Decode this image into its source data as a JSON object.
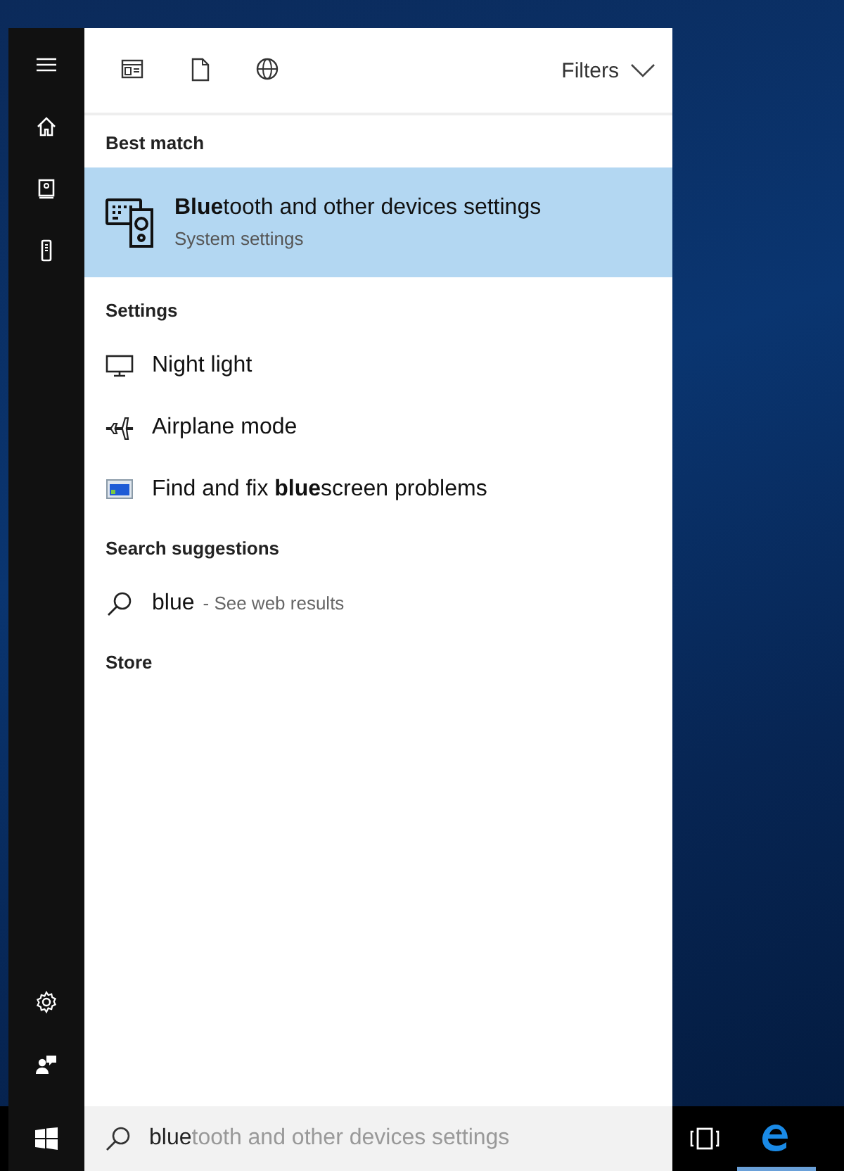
{
  "sidebar": {
    "top": [
      {
        "kind": "menu"
      },
      {
        "kind": "home"
      },
      {
        "kind": "notebook"
      },
      {
        "kind": "devices"
      }
    ],
    "bottom": [
      {
        "kind": "settings"
      },
      {
        "kind": "feedback"
      }
    ]
  },
  "filter_bar": {
    "tabs": [
      {
        "kind": "apps",
        "selected": false
      },
      {
        "kind": "documents",
        "selected": false
      },
      {
        "kind": "web",
        "selected": false
      }
    ],
    "filters_label": "Filters"
  },
  "sections": [
    {
      "heading": "Best match",
      "items": [
        {
          "kind": "bluetooth",
          "title": "**Blue**tooth and other devices settings",
          "subtitle": "System settings",
          "selected": true
        }
      ]
    },
    {
      "heading": "Settings",
      "items": [
        {
          "kind": "display",
          "title": "Night light",
          "selected": false
        },
        {
          "kind": "airplane",
          "title": "Airplane mode",
          "selected": false
        },
        {
          "kind": "troubleshoot",
          "title": "Find and fix **blue**screen problems",
          "selected": false
        }
      ]
    },
    {
      "heading": "Search suggestions",
      "items": [
        {
          "kind": "web",
          "title": "blue",
          "hint": "- See web results",
          "selected": false
        }
      ]
    },
    {
      "heading": "Store"
    }
  ],
  "taskbar": {
    "search": {
      "value": "blue",
      "suggestion": "tooth and other devices settings"
    },
    "apps": [
      {
        "kind": "task-view"
      },
      {
        "kind": "edge",
        "running": true
      }
    ]
  }
}
